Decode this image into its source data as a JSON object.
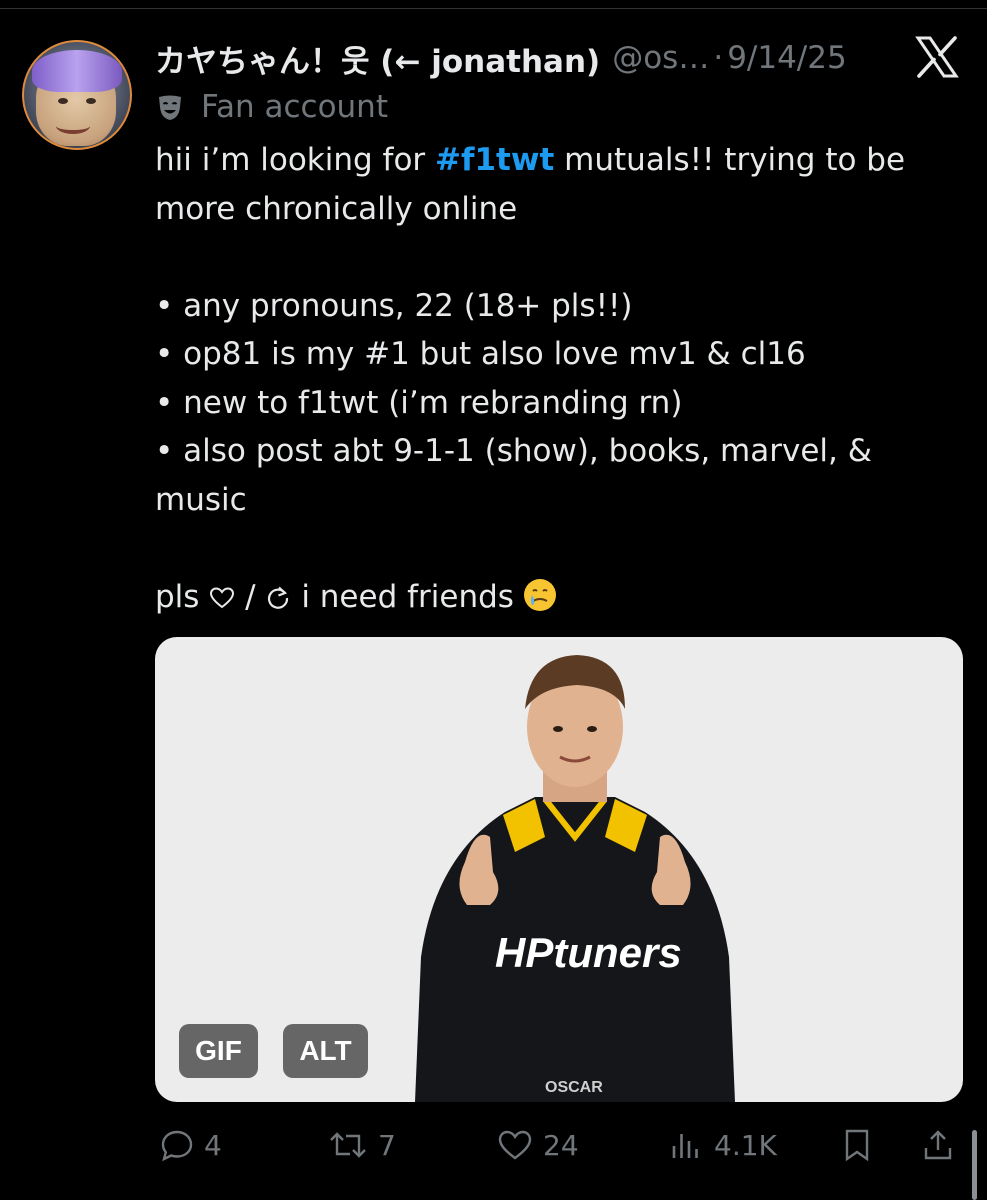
{
  "post": {
    "author": {
      "display_name": "カヤちゃん！웃 (← jonathan)",
      "handle": "@os…",
      "separator": "·",
      "date": "9/14/25",
      "badge_label": "Fan account"
    },
    "text": {
      "line1_pre": "hii i’m looking for ",
      "hashtag": "#f1twt",
      "line1_post": " mutuals!! trying to be more chronically online",
      "bullets": [
        "• any pronouns, 22 (18+ pls!!)",
        "• op81 is my #1 but also love mv1 & cl16",
        "• new to f1twt (i’m rebranding rn)",
        "• also post abt 9-1-1 (show), books, marvel, & music"
      ],
      "closing_pre": "pls",
      "closing_slash": " / ",
      "closing_post": " i need friends"
    },
    "media": {
      "gif_label": "GIF",
      "alt_label": "ALT",
      "suit_brand": "HPtuners",
      "suit_name": "OSCAR"
    },
    "actions": {
      "replies": "4",
      "reposts": "7",
      "likes": "24",
      "views": "4.1K"
    }
  },
  "icons": [
    "avatar",
    "x-logo-icon",
    "theater-mask-icon",
    "heart-outline-icon",
    "refresh-icon",
    "teary-smile-emoji",
    "reply-icon",
    "repost-icon",
    "like-icon",
    "views-icon",
    "bookmark-icon",
    "share-icon"
  ],
  "colors": {
    "background": "#000000",
    "text": "#e7e9ea",
    "muted": "#71767b",
    "link": "#1d9bf0"
  }
}
